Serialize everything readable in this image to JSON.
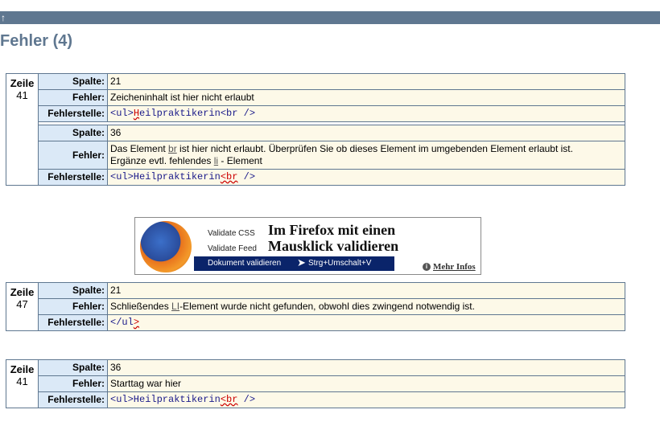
{
  "top_nav": {
    "arrow": "↑"
  },
  "heading": "Fehler (4)",
  "labels": {
    "zeile": "Zeile",
    "spalte": "Spalte:",
    "fehler": "Fehler:",
    "fehlerstelle": "Fehlerstelle:"
  },
  "e1": {
    "line": "41",
    "a": {
      "spalte": "21",
      "fehler": "Zeicheninhalt ist hier nicht erlaubt",
      "code_pre": "<ul>",
      "code_hl": "H",
      "code_post": "eilpraktikerin<br />"
    },
    "b": {
      "spalte": "36",
      "fehler_1": "Das Element ",
      "fehler_link": "br",
      "fehler_2": " ist hier nicht erlaubt. Überprüfen Sie ob dieses Element im umgebenden Element erlaubt ist.",
      "fehler_3": "Ergänze evtl. fehlendes ",
      "fehler_link2": "li",
      "fehler_4": " - Element",
      "code_pre": "<ul>Heilpraktikerin",
      "code_hl": "<br",
      "code_post": " />"
    }
  },
  "banner": {
    "menu_css": "Validate CSS",
    "menu_feed": "Validate Feed",
    "menu_doc": "Dokument validieren",
    "menu_shortcut": "Strg+Umschalt+V",
    "tagline_1": "Im Firefox mit einen",
    "tagline_2": "Mausklick validieren",
    "info_icon": "i",
    "more": "Mehr Infos"
  },
  "e2": {
    "line": "47",
    "spalte": "21",
    "fehler_1": "Schließendes ",
    "fehler_link": "LI",
    "fehler_2": "-Element wurde nicht gefunden, obwohl dies zwingend notwendig ist.",
    "code_pre": "</ul",
    "code_hl": ">"
  },
  "e3": {
    "line": "41",
    "spalte": "36",
    "fehler": "Starttag war hier",
    "code_pre": "<ul>Heilpraktikerin",
    "code_hl": "<br",
    "code_post": " />"
  }
}
